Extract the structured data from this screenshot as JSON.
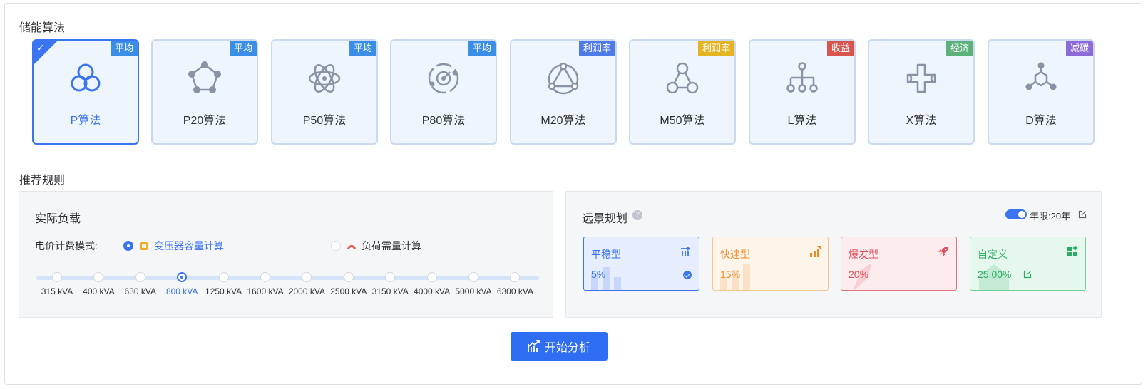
{
  "sections": {
    "algorithms_title": "储能算法",
    "rules_title": "推荐规则"
  },
  "algorithms": [
    {
      "label": "P算法",
      "tag": "平均",
      "tag_color": "#3a8ee6",
      "icon": "three-circles-icon",
      "selected": true
    },
    {
      "label": "P20算法",
      "tag": "平均",
      "tag_color": "#3a8ee6",
      "icon": "pentagon-nodes-icon",
      "selected": false
    },
    {
      "label": "P50算法",
      "tag": "平均",
      "tag_color": "#3a8ee6",
      "icon": "atom-icon",
      "selected": false
    },
    {
      "label": "P80算法",
      "tag": "平均",
      "tag_color": "#3a8ee6",
      "icon": "orbit-icon",
      "selected": false
    },
    {
      "label": "M20算法",
      "tag": "利润率",
      "tag_color": "#4f7ae8",
      "icon": "triangle-nodes-icon",
      "selected": false
    },
    {
      "label": "M50算法",
      "tag": "利润率",
      "tag_color": "#e6b422",
      "icon": "network-nodes-icon",
      "selected": false
    },
    {
      "label": "L算法",
      "tag": "收益",
      "tag_color": "#d9534f",
      "icon": "hierarchy-icon",
      "selected": false
    },
    {
      "label": "X算法",
      "tag": "经济",
      "tag_color": "#5bb17a",
      "icon": "cross-loop-icon",
      "selected": false
    },
    {
      "label": "D算法",
      "tag": "减碳",
      "tag_color": "#8e6ad8",
      "icon": "molecule-icon",
      "selected": false
    }
  ],
  "actual_load": {
    "title": "实际负载",
    "mode_label": "电价计费模式:",
    "options": [
      {
        "label": "变压器容量计算",
        "checked": true
      },
      {
        "label": "负荷需量计算",
        "checked": false
      }
    ],
    "capacities": [
      "315 kVA",
      "400 kVA",
      "630 kVA",
      "800 kVA",
      "1250 kVA",
      "1600 kVA",
      "2000 kVA",
      "2500 kVA",
      "3150 kVA",
      "4000 kVA",
      "5000 kVA",
      "6300 kVA"
    ],
    "selected_capacity": "800 kVA"
  },
  "vision": {
    "title": "远景规划",
    "help": "?",
    "years_label": "年限:20年",
    "toggle_on": true,
    "types": [
      {
        "name": "平稳型",
        "value": "5%",
        "selected": true
      },
      {
        "name": "快速型",
        "value": "15%",
        "selected": false
      },
      {
        "name": "爆发型",
        "value": "20%",
        "selected": false
      },
      {
        "name": "自定义",
        "value": "25.00%",
        "selected": false
      }
    ]
  },
  "actions": {
    "start_label": "开始分析"
  },
  "colors": {
    "primary": "#2f6df2",
    "card_bg": "#eef5fd",
    "card_border": "#c9d9ef",
    "icon_gray": "#8a93a6"
  }
}
